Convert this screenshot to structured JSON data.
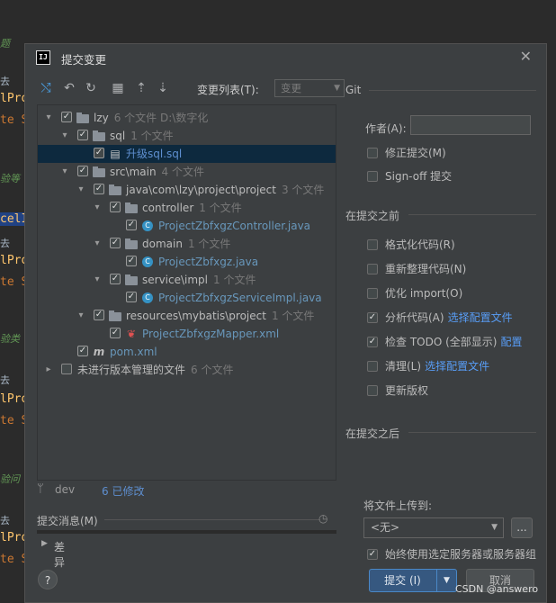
{
  "editor": {
    "lines": [
      {
        "text": "题",
        "kind": "comment"
      },
      {
        "text": "去",
        "kind": "muted"
      },
      {
        "text": "lPro",
        "kind": "ident"
      },
      {
        "text": "te S",
        "kind": "kw"
      },
      {
        "text": "验等",
        "kind": "comment"
      },
      {
        "text": "celI",
        "kind": "sel"
      },
      {
        "text": "去",
        "kind": "muted"
      },
      {
        "text": "lPro",
        "kind": "ident"
      },
      {
        "text": "te S",
        "kind": "kw"
      },
      {
        "text": "验类",
        "kind": "comment"
      },
      {
        "text": "去",
        "kind": "muted"
      },
      {
        "text": "lPro",
        "kind": "ident"
      },
      {
        "text": "te S",
        "kind": "kw"
      },
      {
        "text": "验问",
        "kind": "comment"
      },
      {
        "text": "去",
        "kind": "muted"
      },
      {
        "text": "lPro",
        "kind": "ident"
      },
      {
        "text": "te S",
        "kind": "kw"
      }
    ]
  },
  "dialog": {
    "logo": "IJ",
    "title": "提交变更",
    "close_icon": "close-icon"
  },
  "toolbar": {
    "changelist_label": "变更列表(T):",
    "changelist_value": "变更"
  },
  "tree": [
    {
      "id": "lzy",
      "label": "lzy",
      "meta": "6 个文件  D:\\数字化",
      "type": "folder",
      "level": 0,
      "expanded": true,
      "checked": true
    },
    {
      "id": "sql",
      "label": "sql",
      "meta": "1 个文件",
      "type": "folder",
      "level": 1,
      "expanded": true,
      "checked": true
    },
    {
      "id": "upgrade-sql",
      "label": "升级sql.sql",
      "meta": "",
      "type": "sql",
      "level": 2,
      "checked": true,
      "color": "blue2",
      "selected": true
    },
    {
      "id": "src-main",
      "label": "src\\main",
      "meta": "4 个文件",
      "type": "folder",
      "level": 1,
      "expanded": true,
      "checked": true
    },
    {
      "id": "java-pkg",
      "label": "java\\com\\lzy\\project\\project",
      "meta": "3 个文件",
      "type": "folder",
      "level": 2,
      "expanded": true,
      "checked": true
    },
    {
      "id": "controller",
      "label": "controller",
      "meta": "1 个文件",
      "type": "folder",
      "level": 3,
      "expanded": true,
      "checked": true
    },
    {
      "id": "controller-java",
      "label": "ProjectZbfxgzController.java",
      "meta": "",
      "type": "java",
      "level": 4,
      "checked": true,
      "color": "blue"
    },
    {
      "id": "domain",
      "label": "domain",
      "meta": "1 个文件",
      "type": "folder",
      "level": 3,
      "expanded": true,
      "checked": true
    },
    {
      "id": "domain-java",
      "label": "ProjectZbfxgz.java",
      "meta": "",
      "type": "java",
      "level": 4,
      "checked": true,
      "color": "blue"
    },
    {
      "id": "service-impl",
      "label": "service\\impl",
      "meta": "1 个文件",
      "type": "folder",
      "level": 3,
      "expanded": true,
      "checked": true
    },
    {
      "id": "service-java",
      "label": "ProjectZbfxgzServiceImpl.java",
      "meta": "",
      "type": "java",
      "level": 4,
      "checked": true,
      "color": "blue"
    },
    {
      "id": "resources",
      "label": "resources\\mybatis\\project",
      "meta": "1 个文件",
      "type": "folder",
      "level": 2,
      "expanded": true,
      "checked": true
    },
    {
      "id": "mapper-xml",
      "label": "ProjectZbfxgzMapper.xml",
      "meta": "",
      "type": "xml",
      "level": 3,
      "checked": true,
      "color": "blue"
    },
    {
      "id": "pom",
      "label": "pom.xml",
      "meta": "",
      "type": "maven",
      "level": 1,
      "checked": true,
      "color": "blue"
    },
    {
      "id": "unversioned",
      "label": "未进行版本管理的文件",
      "meta": "6 个文件",
      "type": "none",
      "level": 0,
      "expanded": false,
      "checked": false,
      "collapsed": true
    }
  ],
  "status": {
    "branch": "dev",
    "modified": "6 已修改"
  },
  "commit_message": {
    "label": "提交消息(M)"
  },
  "diff": {
    "label": "差异"
  },
  "right": {
    "git_title": "Git",
    "author_label": "作者(A):",
    "author_value": "",
    "amend": "修正提交(M)",
    "signoff": "Sign-off 提交",
    "before_title": "在提交之前",
    "before_options": [
      {
        "label": "格式化代码(R)",
        "checked": false,
        "link": ""
      },
      {
        "label": "重新整理代码(N)",
        "checked": false,
        "link": ""
      },
      {
        "label": "优化 import(O)",
        "checked": false,
        "link": ""
      },
      {
        "label": "分析代码(A)",
        "checked": true,
        "link": "选择配置文件"
      },
      {
        "label": "检查 TODO (全部显示)",
        "checked": true,
        "link": "配置"
      },
      {
        "label": "清理(L)",
        "checked": false,
        "link": "选择配置文件"
      },
      {
        "label": "更新版权",
        "checked": false,
        "link": ""
      }
    ],
    "after_title": "在提交之后",
    "upload_label": "将文件上传到:",
    "upload_value": "<无>",
    "browse_label": "...",
    "always_use": "始终使用选定服务器或服务器组",
    "always_use_checked": true
  },
  "buttons": {
    "help": "?",
    "commit": "提交 (I)",
    "cancel": "取消"
  },
  "watermark": "CSDN @answero"
}
